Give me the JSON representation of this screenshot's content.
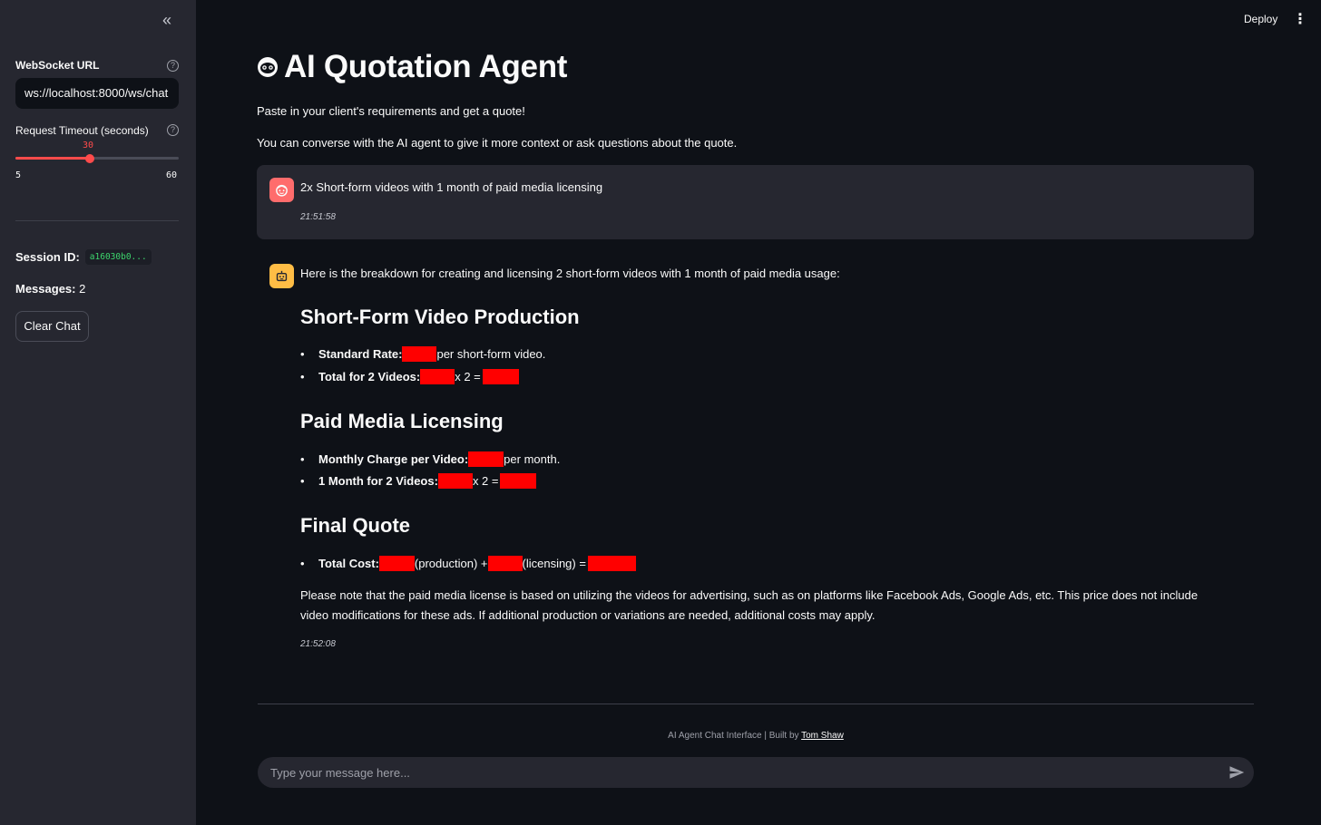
{
  "sidebar": {
    "collapse_icon": "double-chevron-left-icon",
    "websocket_label": "WebSocket URL",
    "websocket_value": "ws://localhost:8000/ws/chat",
    "timeout_label": "Request Timeout (seconds)",
    "timeout_value": "30",
    "timeout_min": "5",
    "timeout_max": "60",
    "timeout_fraction": 0.4545,
    "session_label": "Session ID:",
    "session_value": "a16030b0...",
    "messages_label": "Messages:",
    "messages_value": "2",
    "clear_button": "Clear Chat"
  },
  "header": {
    "deploy_label": "Deploy",
    "menu_icon": "kebab-menu-icon"
  },
  "main": {
    "title": "AI Quotation Agent",
    "title_icon": "robot-face-icon",
    "intro_1": "Paste in your client's requirements and get a quote!",
    "intro_2": "You can converse with the AI agent to give it more context or ask questions about the quote."
  },
  "user_message": {
    "text": "2x Short-form videos with 1 month of paid media licensing",
    "time": "21:51:58"
  },
  "bot_message": {
    "intro": "Here is the breakdown for creating and licensing 2 short-form videos with 1 month of paid media usage:",
    "section_1": {
      "heading": "Short-Form Video Production",
      "b1_label": "Standard Rate:",
      "b1_after": "per short-form video.",
      "b2_label": "Total for 2 Videos:",
      "b2_mid": "x 2 ="
    },
    "section_2": {
      "heading": "Paid Media Licensing",
      "b1_label": "Monthly Charge per Video:",
      "b1_after": "per month.",
      "b2_label": "1 Month for 2 Videos:",
      "b2_mid": "x 2 ="
    },
    "section_3": {
      "heading": "Final Quote",
      "b1_label": "Total Cost:",
      "b1_mid1": "(production) +",
      "b1_mid2": "(licensing) ="
    },
    "note": "Please note that the paid media license is based on utilizing the videos for advertising, such as on platforms like Facebook Ads, Google Ads, etc. This price does not include video modifications for these ads. If additional production or variations are needed, additional costs may apply.",
    "time": "21:52:08"
  },
  "footer": {
    "text": "AI Agent Chat Interface | Built by ",
    "link": "Tom Shaw"
  },
  "chat_input": {
    "placeholder": "Type your message here...",
    "send_icon": "send-icon"
  },
  "colors": {
    "accent": "#ff4b4b",
    "redaction": "#ff0000",
    "user_avatar": "#ff6c6c",
    "bot_avatar": "#ffbd45",
    "session_code": "#3dd56d"
  }
}
